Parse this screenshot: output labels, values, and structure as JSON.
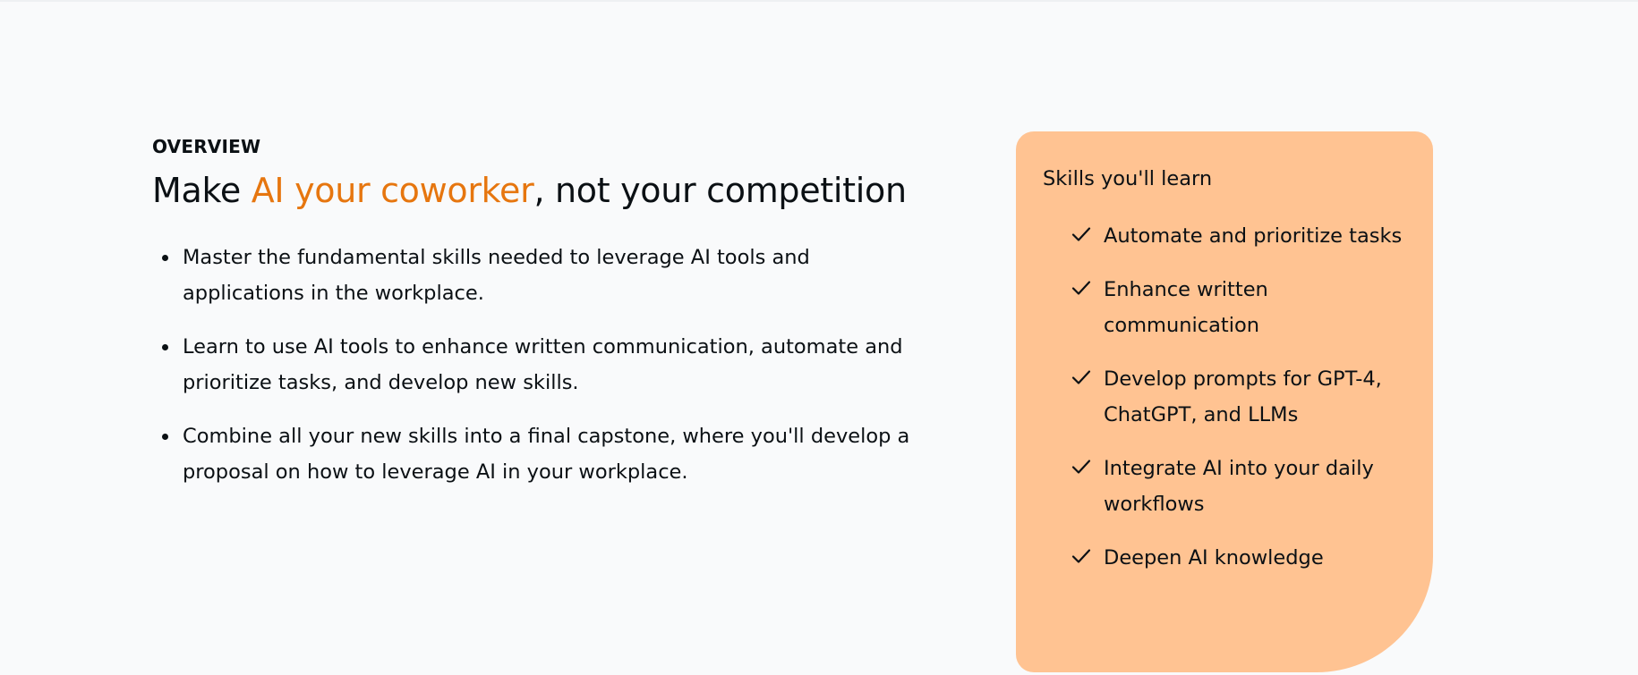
{
  "overview": {
    "eyebrow": "OVERVIEW",
    "headline": {
      "prefix": "Make ",
      "accent": "AI your coworker",
      "suffix": ", not your competition"
    },
    "bullets": [
      "Master the fundamental skills needed to leverage AI tools and applications in the workplace.",
      "Learn to use AI tools to enhance written communication, automate and prioritize tasks, and develop new skills.",
      "Combine all your new skills into a final capstone, where you'll develop a proposal on how to leverage AI in your workplace."
    ]
  },
  "skills": {
    "title": "Skills you'll learn",
    "items": [
      "Automate and prioritize tasks",
      "Enhance written communication",
      "Develop prompts for GPT-4, ChatGPT, and LLMs",
      "Integrate AI into your daily workflows",
      "Deepen AI knowledge"
    ],
    "item_icon": "check-icon"
  },
  "colors": {
    "background": "#f9fafb",
    "text": "#0b1014",
    "accent": "#e6760f",
    "card": "#ffc392"
  }
}
